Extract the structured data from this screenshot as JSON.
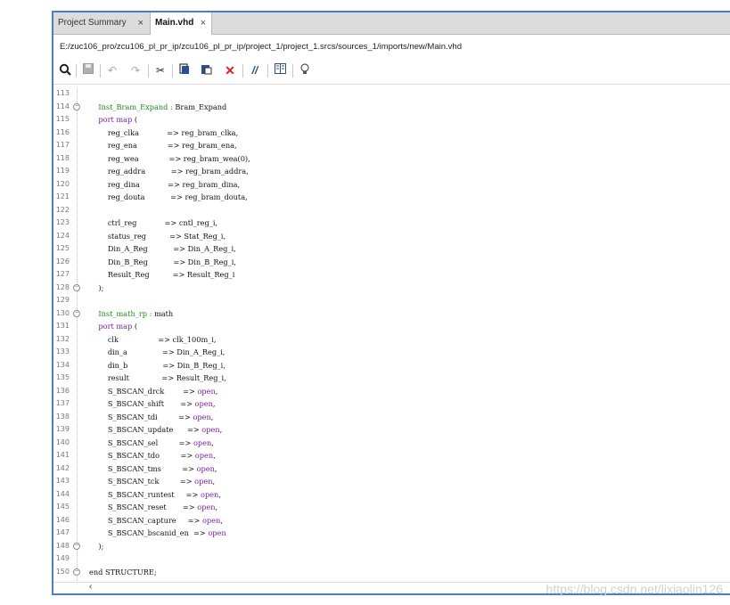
{
  "tabs": [
    {
      "label": "Project Summary",
      "active": false
    },
    {
      "label": "Main.vhd",
      "active": true
    }
  ],
  "tab_close_glyph": "×",
  "file_path": "E:/zuc106_pro/zcu106_pl_pr_ip/zcu106_pl_pr_ip/project_1/project_1.srcs/sources_1/imports/new/Main.vhd",
  "toolbar": [
    {
      "name": "search-icon",
      "glyph": "🔍"
    },
    {
      "name": "save-icon",
      "glyph": "💾"
    },
    {
      "name": "undo-icon",
      "glyph": "↶"
    },
    {
      "name": "redo-icon",
      "glyph": "↷"
    },
    {
      "name": "cut-icon",
      "glyph": "✂"
    },
    {
      "name": "copy-icon",
      "glyph": "❐"
    },
    {
      "name": "paste-icon",
      "glyph": "📋"
    },
    {
      "name": "delete-icon",
      "glyph": "✕"
    },
    {
      "name": "comment-icon",
      "glyph": "//"
    },
    {
      "name": "columns-icon",
      "glyph": "▥"
    },
    {
      "name": "hint-icon",
      "glyph": "💡"
    }
  ],
  "lines": [
    {
      "n": "113",
      "fold": "",
      "parts": []
    },
    {
      "n": "114",
      "fold": "−",
      "parts": [
        {
          "t": "    "
        },
        {
          "t": "Inst_Bram_Expand : ",
          "c": "lbl"
        },
        {
          "t": "Bram_Expand"
        }
      ]
    },
    {
      "n": "115",
      "fold": "",
      "parts": [
        {
          "t": "    "
        },
        {
          "t": "port map",
          "c": "kw"
        },
        {
          "t": " ("
        }
      ]
    },
    {
      "n": "116",
      "fold": "",
      "parts": [
        {
          "t": "        reg_clka            => reg_bram_clka,"
        }
      ]
    },
    {
      "n": "117",
      "fold": "",
      "parts": [
        {
          "t": "        reg_ena             => reg_bram_ena,"
        }
      ]
    },
    {
      "n": "118",
      "fold": "",
      "parts": [
        {
          "t": "        reg_wea             => reg_bram_wea(0),"
        }
      ]
    },
    {
      "n": "119",
      "fold": "",
      "parts": [
        {
          "t": "        reg_addra           => reg_bram_addra,"
        }
      ]
    },
    {
      "n": "120",
      "fold": "",
      "parts": [
        {
          "t": "        reg_dina            => reg_bram_dina,"
        }
      ]
    },
    {
      "n": "121",
      "fold": "",
      "parts": [
        {
          "t": "        reg_douta           => reg_bram_douta,"
        }
      ]
    },
    {
      "n": "122",
      "fold": "",
      "parts": []
    },
    {
      "n": "123",
      "fold": "",
      "parts": [
        {
          "t": "        ctrl_reg            => cntl_reg_i,"
        }
      ]
    },
    {
      "n": "124",
      "fold": "",
      "parts": [
        {
          "t": "        status_reg          => Stat_Reg_i,"
        }
      ]
    },
    {
      "n": "125",
      "fold": "",
      "parts": [
        {
          "t": "        Din_A_Reg           => Din_A_Reg_i,"
        }
      ]
    },
    {
      "n": "126",
      "fold": "",
      "parts": [
        {
          "t": "        Din_B_Reg           => Din_B_Reg_i,"
        }
      ]
    },
    {
      "n": "127",
      "fold": "",
      "parts": [
        {
          "t": "        Result_Reg          => Result_Reg_i"
        }
      ]
    },
    {
      "n": "128",
      "fold": "−",
      "parts": [
        {
          "t": "    );"
        }
      ]
    },
    {
      "n": "129",
      "fold": "",
      "parts": []
    },
    {
      "n": "130",
      "fold": "−",
      "parts": [
        {
          "t": "    "
        },
        {
          "t": "Inst_math_rp : ",
          "c": "lbl"
        },
        {
          "t": "math"
        }
      ]
    },
    {
      "n": "131",
      "fold": "",
      "parts": [
        {
          "t": "    "
        },
        {
          "t": "port map",
          "c": "kw"
        },
        {
          "t": " ("
        }
      ]
    },
    {
      "n": "132",
      "fold": "",
      "parts": [
        {
          "t": "        clk                 => clk_100m_i,"
        }
      ]
    },
    {
      "n": "133",
      "fold": "",
      "parts": [
        {
          "t": "        din_a               => Din_A_Reg_i,"
        }
      ]
    },
    {
      "n": "134",
      "fold": "",
      "parts": [
        {
          "t": "        din_b               => Din_B_Reg_i,"
        }
      ]
    },
    {
      "n": "135",
      "fold": "",
      "parts": [
        {
          "t": "        result              => Result_Reg_i,"
        }
      ]
    },
    {
      "n": "136",
      "fold": "",
      "parts": [
        {
          "t": "        S_BSCAN_drck        => "
        },
        {
          "t": "open",
          "c": "kw"
        },
        {
          "t": ","
        }
      ]
    },
    {
      "n": "137",
      "fold": "",
      "parts": [
        {
          "t": "        S_BSCAN_shift       => "
        },
        {
          "t": "open",
          "c": "kw"
        },
        {
          "t": ","
        }
      ]
    },
    {
      "n": "138",
      "fold": "",
      "parts": [
        {
          "t": "        S_BSCAN_tdi         => "
        },
        {
          "t": "open",
          "c": "kw"
        },
        {
          "t": ","
        }
      ]
    },
    {
      "n": "139",
      "fold": "",
      "parts": [
        {
          "t": "        S_BSCAN_update      => "
        },
        {
          "t": "open",
          "c": "kw"
        },
        {
          "t": ","
        }
      ]
    },
    {
      "n": "140",
      "fold": "",
      "parts": [
        {
          "t": "        S_BSCAN_sel         => "
        },
        {
          "t": "open",
          "c": "kw"
        },
        {
          "t": ","
        }
      ]
    },
    {
      "n": "141",
      "fold": "",
      "parts": [
        {
          "t": "        S_BSCAN_tdo         => "
        },
        {
          "t": "open",
          "c": "kw"
        },
        {
          "t": ","
        }
      ]
    },
    {
      "n": "142",
      "fold": "",
      "parts": [
        {
          "t": "        S_BSCAN_tms         => "
        },
        {
          "t": "open",
          "c": "kw"
        },
        {
          "t": ","
        }
      ]
    },
    {
      "n": "143",
      "fold": "",
      "parts": [
        {
          "t": "        S_BSCAN_tck         => "
        },
        {
          "t": "open",
          "c": "kw"
        },
        {
          "t": ","
        }
      ]
    },
    {
      "n": "144",
      "fold": "",
      "parts": [
        {
          "t": "        S_BSCAN_runtest     => "
        },
        {
          "t": "open",
          "c": "kw"
        },
        {
          "t": ","
        }
      ]
    },
    {
      "n": "145",
      "fold": "",
      "parts": [
        {
          "t": "        S_BSCAN_reset       => "
        },
        {
          "t": "open",
          "c": "kw"
        },
        {
          "t": ","
        }
      ]
    },
    {
      "n": "146",
      "fold": "",
      "parts": [
        {
          "t": "        S_BSCAN_capture     => "
        },
        {
          "t": "open",
          "c": "kw"
        },
        {
          "t": ","
        }
      ]
    },
    {
      "n": "147",
      "fold": "",
      "parts": [
        {
          "t": "        S_BSCAN_bscanid_en  => "
        },
        {
          "t": "open",
          "c": "kw"
        }
      ]
    },
    {
      "n": "148",
      "fold": "−",
      "parts": [
        {
          "t": "    );"
        }
      ]
    },
    {
      "n": "149",
      "fold": "",
      "parts": []
    },
    {
      "n": "150",
      "fold": "−",
      "parts": [
        {
          "t": "end STRUCTURE;"
        }
      ]
    }
  ],
  "scroll_left_glyph": "‹",
  "watermark": "https://blog.csdn.net/lixiaolin126",
  "colors": {
    "frame": "#4a7fc8",
    "keyword": "#7a1fa2",
    "label": "#1e8a1e",
    "delete": "#e02020"
  }
}
